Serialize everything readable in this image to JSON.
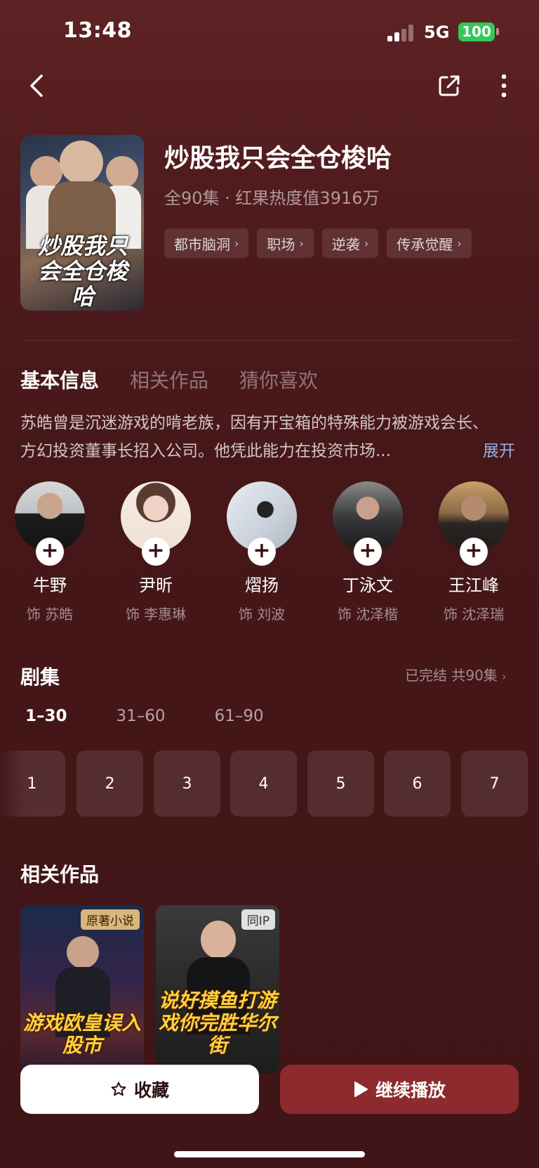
{
  "status_bar": {
    "time": "13:48",
    "network": "5G",
    "battery": "100"
  },
  "drama": {
    "title": "炒股我只会全仓梭哈",
    "meta": "全90集 · 红果热度值3916万",
    "poster_text": "炒股我只会全仓梭哈",
    "tags": [
      "都市脑洞",
      "职场",
      "逆袭",
      "传承觉醒"
    ]
  },
  "tabs": [
    "基本信息",
    "相关作品",
    "猜你喜欢"
  ],
  "description": "苏皓曾是沉迷游戏的啃老族，因有开宝箱的特殊能力被游戏会长、方幻投资董事长招入公司。他凭此能力在投资市场...",
  "expand_label": "展开",
  "cast": [
    {
      "name": "牛野",
      "role": "饰 苏皓"
    },
    {
      "name": "尹昕",
      "role": "饰 李惠琳"
    },
    {
      "name": "熠扬",
      "role": "饰 刘波"
    },
    {
      "name": "丁泳文",
      "role": "饰 沈泽楷"
    },
    {
      "name": "王江峰",
      "role": "饰 沈泽瑞"
    }
  ],
  "episodes": {
    "title": "剧集",
    "status": "已完结 共90集",
    "ranges": [
      "1–30",
      "31–60",
      "61–90"
    ],
    "items": [
      "1",
      "2",
      "3",
      "4",
      "5",
      "6",
      "7"
    ]
  },
  "related": {
    "title": "相关作品",
    "items": [
      {
        "badge": "原著小说",
        "poster_text": "游戏欧皇误入股市"
      },
      {
        "badge": "同IP",
        "poster_text": "说好摸鱼打游戏你完胜华尔街"
      }
    ]
  },
  "actions": {
    "favorite": "收藏",
    "play": "继续播放"
  },
  "colors": {
    "accent": "#8c2a2d",
    "battery": "#34c759",
    "link": "#8fb3e6"
  }
}
